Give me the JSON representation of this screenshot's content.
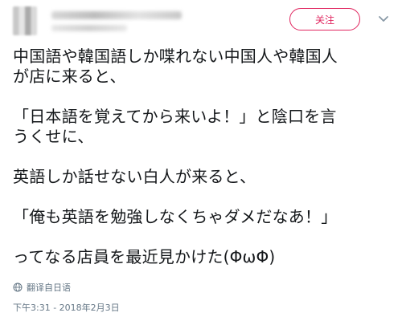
{
  "header": {
    "follow_label": "关注",
    "caret_icon": "chevron-down-icon"
  },
  "tweet": {
    "lines": [
      "中国語や韓国語しか喋れない中国人や韓国人",
      "が店に来ると、",
      "",
      "「日本語を覚えてから来いよ！」と陰口を言",
      "うくせに、",
      "",
      "英語しか話せない白人が来ると、",
      "",
      "「俺も英語を勉強しなくちゃダメだなあ！」",
      "",
      "ってなる店員を最近見かけた(ΦωΦ)"
    ]
  },
  "translate": {
    "label": "翻译自日语",
    "icon": "globe-icon"
  },
  "timestamp": "下午3:31 - 2018年2月3日",
  "colors": {
    "follow": "#e0245e",
    "meta": "#657786",
    "text": "#14171a"
  }
}
